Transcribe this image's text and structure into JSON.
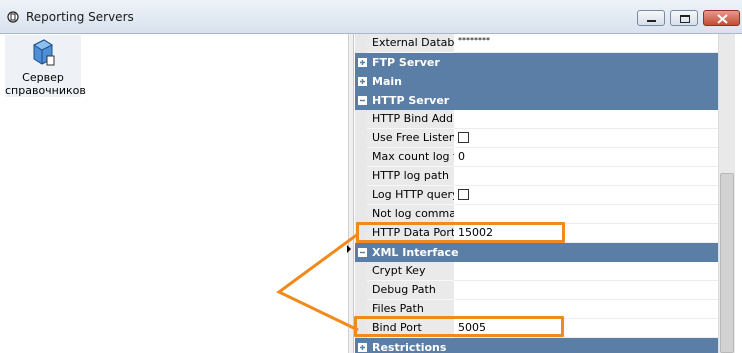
{
  "window": {
    "title": "Reporting Servers",
    "buttons": [
      "minimize",
      "maximize",
      "close"
    ]
  },
  "tree": {
    "items": [
      {
        "label_line1": "Сервер",
        "label_line2": "справочников",
        "icon": "server-cube-icon"
      }
    ]
  },
  "properties": {
    "top_row": {
      "name": "External Databas",
      "value": "********"
    },
    "categories": {
      "ftp": "FTP Server",
      "main": "Main",
      "http": "HTTP Server",
      "xml": "XML Interface",
      "restrictions": "Restrictions"
    },
    "http_rows": [
      {
        "name": "HTTP Bind Addre",
        "value": ""
      },
      {
        "name": "Use Free Listen F",
        "value": ""
      },
      {
        "name": "Max count log file",
        "value": "0"
      },
      {
        "name": "HTTP log path",
        "value": ""
      },
      {
        "name": "Log HTTP query",
        "value": ""
      },
      {
        "name": "Not log command",
        "value": ""
      },
      {
        "name": "HTTP Data Port",
        "value": "15002"
      }
    ],
    "xml_rows": [
      {
        "name": "Crypt Key",
        "value": ""
      },
      {
        "name": "Debug Path",
        "value": ""
      },
      {
        "name": "Files Path",
        "value": ""
      },
      {
        "name": "Bind Port",
        "value": "5005"
      }
    ]
  },
  "colors": {
    "category_header": "#5b7ea6",
    "highlight": "#f08a1c",
    "title_bar": "#dce6f1"
  }
}
